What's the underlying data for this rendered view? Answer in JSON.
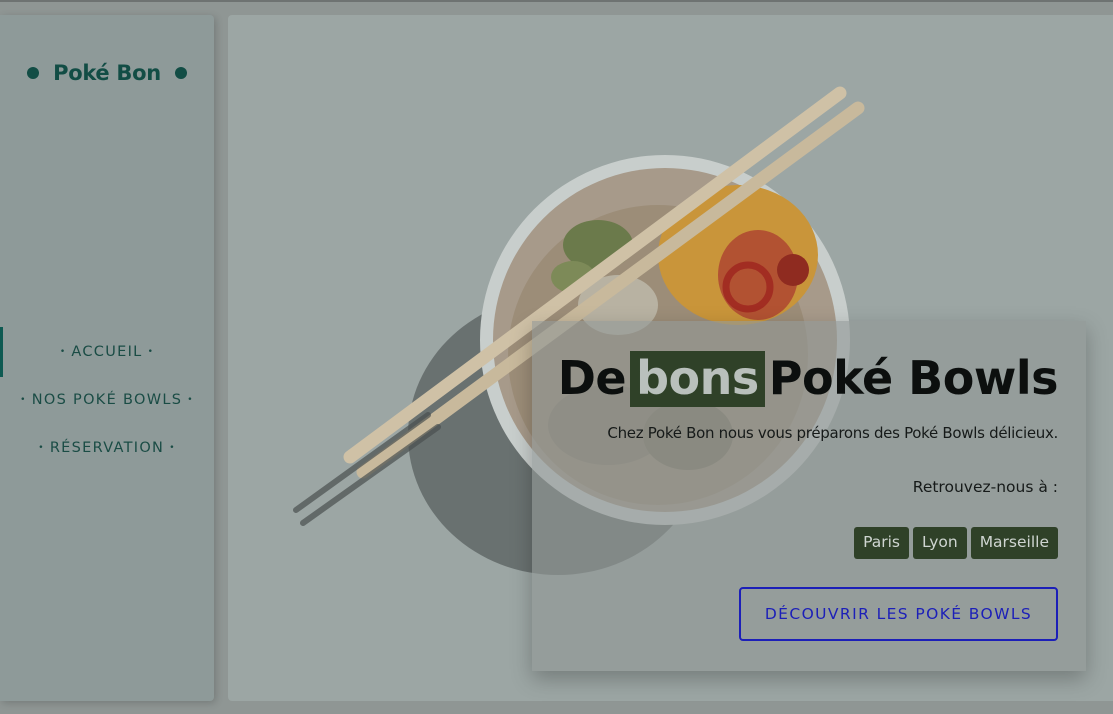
{
  "brand": {
    "name": "Poké Bon"
  },
  "nav": {
    "items": [
      {
        "label": "ACCUEIL",
        "active": true
      },
      {
        "label": "NOS POKÉ BOWLS",
        "active": false
      },
      {
        "label": "RÉSERVATION",
        "active": false
      }
    ],
    "bullet": "•"
  },
  "hero": {
    "image": "poke-bowl-with-chopsticks",
    "title_before": "De",
    "title_highlight": "bons",
    "title_after": "Poké Bowls",
    "subtitle": "Chez Poké Bon nous vous préparons des Poké Bowls délicieux.",
    "find_us": "Retrouvez-nous à :",
    "cities": [
      "Paris",
      "Lyon",
      "Marseille"
    ],
    "cta_label": "DÉCOUVRIR LES POKÉ BOWLS"
  },
  "colors": {
    "brand_green": "#124d45",
    "highlight_dark": "#2f4128",
    "cta_blue": "#1c1fb8"
  }
}
